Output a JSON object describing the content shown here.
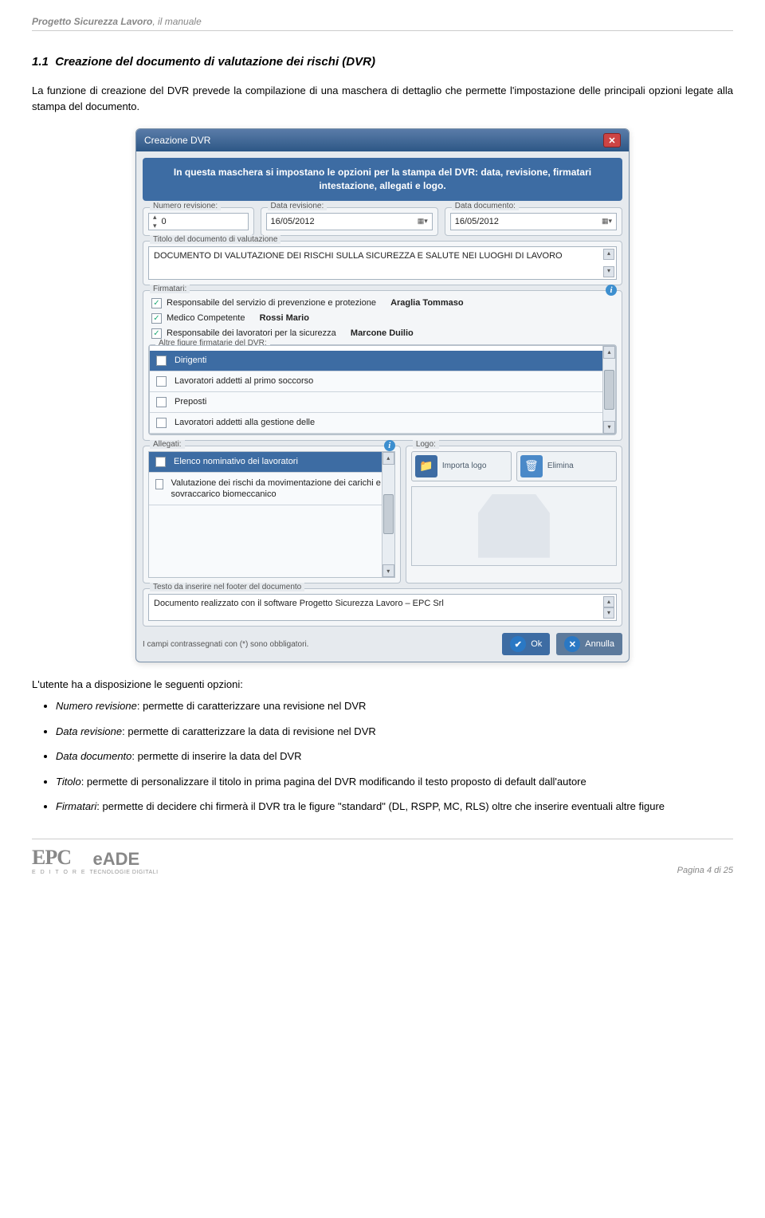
{
  "header": {
    "title_bold": "Progetto Sicurezza Lavoro",
    "title_rest": ", il manuale"
  },
  "section": {
    "number": "1.1",
    "title": "Creazione del documento di valutazione dei rischi (DVR)"
  },
  "intro": "La funzione di creazione del DVR prevede la compilazione di una maschera di dettaglio che permette l'impostazione delle principali opzioni legate alla stampa del documento.",
  "dialog": {
    "title": "Creazione DVR",
    "instruction": "In questa maschera si impostano le opzioni per la stampa del DVR: data, revisione, firmatari intestazione, allegati e logo.",
    "fields": {
      "numero_revisione_label": "Numero revisione:",
      "numero_revisione_value": "0",
      "data_revisione_label": "Data revisione:",
      "data_revisione_value": "16/05/2012",
      "data_documento_label": "Data documento:",
      "data_documento_value": "16/05/2012",
      "titolo_label": "Titolo del documento di valutazione",
      "titolo_value": "DOCUMENTO DI VALUTAZIONE DEI RISCHI  SULLA SICUREZZA E SALUTE NEI LUOGHI DI LAVORO"
    },
    "firmatari": {
      "label": "Firmatari:",
      "rspp_label": "Responsabile del servizio di prevenzione e protezione",
      "rspp_name": "Araglia Tommaso",
      "medico_label": "Medico Competente",
      "medico_name": "Rossi Mario",
      "rls_label": "Responsabile dei lavoratori per la sicurezza",
      "rls_name": "Marcone Duilio",
      "altre_label": "Altre figure firmatarie del DVR:",
      "altre_items": [
        "Dirigenti",
        "Lavoratori addetti al primo soccorso",
        "Preposti",
        "Lavoratori addetti alla gestione delle"
      ]
    },
    "allegati": {
      "label": "Allegati:",
      "items": [
        "Elenco nominativo dei lavoratori",
        "Valutazione dei rischi da movimentazione dei carichi e sovraccarico biomeccanico"
      ]
    },
    "logo": {
      "label": "Logo:",
      "importa": "Importa logo",
      "elimina": "Elimina"
    },
    "footer_text": {
      "label": "Testo da inserire nel footer del documento",
      "value": "Documento realizzato con il software Progetto Sicurezza Lavoro – EPC Srl"
    },
    "mandatory_note": "I campi contrassegnati con (*) sono obbligatori.",
    "ok": "Ok",
    "annulla": "Annulla"
  },
  "after_dialog": "L'utente ha a disposizione le seguenti opzioni:",
  "options": [
    {
      "name": "Numero revisione",
      "desc": ": permette di caratterizzare una revisione nel DVR"
    },
    {
      "name": "Data revisione",
      "desc": ": permette di caratterizzare la data di revisione nel DVR"
    },
    {
      "name": "Data documento",
      "desc": ": permette di inserire la data del DVR"
    },
    {
      "name": "Titolo",
      "desc": ": permette di personalizzare il titolo in prima pagina del DVR modificando il testo proposto di default dall'autore"
    },
    {
      "name": "Firmatari",
      "desc": ": permette di decidere chi firmerà il DVR tra le figure \"standard\" (DL, RSPP, MC, RLS) oltre che inserire eventuali altre figure"
    }
  ],
  "footer": {
    "logo1": "EPC",
    "logo1_sub": "E D I T O R E",
    "logo2": "eADE",
    "logo2_sub": "TECNOLOGIE DIGITALI",
    "page": "Pagina 4 di 25"
  }
}
